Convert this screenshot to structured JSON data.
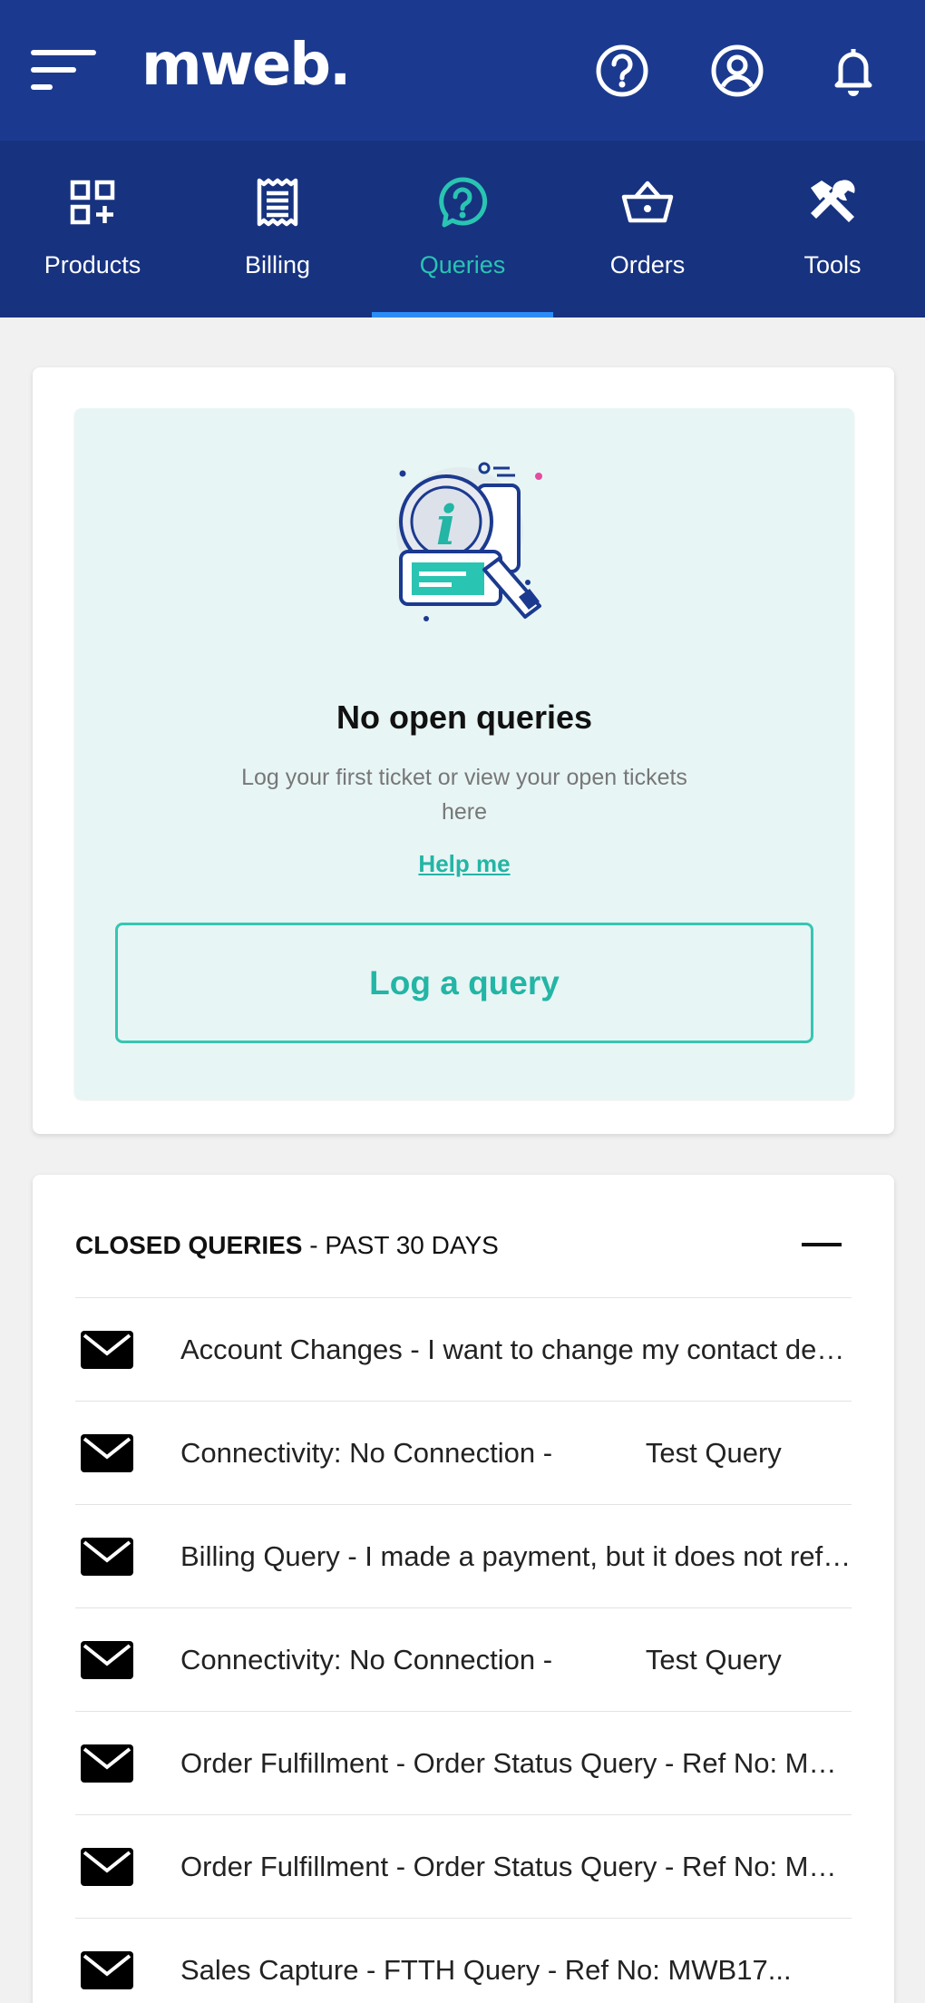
{
  "header": {
    "logo_text": "mweb.",
    "bg_color": "#1b3a8f",
    "icons": [
      "menu-icon",
      "help-circle-icon",
      "account-icon",
      "bell-icon"
    ]
  },
  "tabs": [
    {
      "label": "Products",
      "icon": "products-grid-icon",
      "active": false
    },
    {
      "label": "Billing",
      "icon": "receipt-icon",
      "active": false
    },
    {
      "label": "Queries",
      "icon": "question-bubble-icon",
      "active": true
    },
    {
      "label": "Orders",
      "icon": "basket-icon",
      "active": false
    },
    {
      "label": "Tools",
      "icon": "tools-icon",
      "active": false
    }
  ],
  "open_queries": {
    "title": "No open queries",
    "subtitle": "Log your first ticket or view your open tickets here",
    "help_link": "Help me",
    "button_label": "Log a query",
    "accent_color": "#23b5a5"
  },
  "closed_queries": {
    "heading_bold": "CLOSED QUERIES",
    "heading_separator": " - ",
    "heading_rest": "PAST 30 DAYS",
    "items": [
      {
        "text": "Account Changes - I want to change my contact details"
      },
      {
        "text": "Connectivity: No Connection -            Test Query"
      },
      {
        "text": "Billing Query - I made a payment, but it does not reflect"
      },
      {
        "text": "Connectivity: No Connection -            Test Query"
      },
      {
        "text": "Order Fulfillment - Order Status Query - Ref No: MWB"
      },
      {
        "text": "Order Fulfillment - Order Status Query - Ref No: MWB"
      },
      {
        "text": "Sales Capture - FTTH Query - Ref No: MWB17..."
      }
    ]
  }
}
